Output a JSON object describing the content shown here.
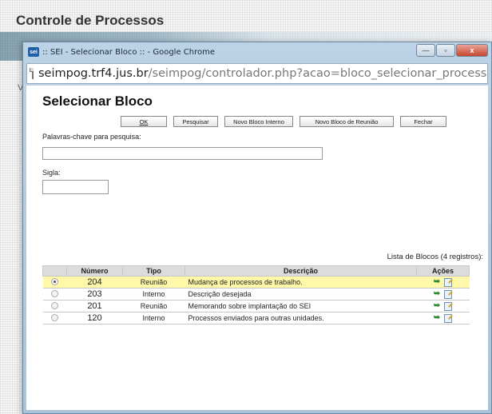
{
  "background": {
    "heading": "Controle de Processos",
    "left_letter": "V"
  },
  "window": {
    "title": ":: SEI - Selecionar Bloco :: - Google Chrome",
    "app_icon_label": "sei",
    "controls": {
      "minimize": "—",
      "maximize": "▫",
      "close": "x"
    }
  },
  "address": {
    "host": "seimpog.trf4.jus.br",
    "path": "/seimpog/controlador.php?acao=bloco_selecionar_processo&acao_origem=bl"
  },
  "page": {
    "title": "Selecionar Bloco",
    "buttons": {
      "ok": "OK",
      "pesquisar": "Pesquisar",
      "novo_interno": "Novo Bloco Interno",
      "novo_reuniao": "Novo Bloco de Reunião",
      "fechar": "Fechar"
    },
    "keywords_label": "Palavras-chave para pesquisa:",
    "keywords_value": "",
    "sigla_label": "Sigla:",
    "sigla_value": "",
    "table_caption": "Lista de Blocos (4 registros):",
    "table": {
      "headers": [
        "",
        "Número",
        "Tipo",
        "Descrição",
        "Ações"
      ],
      "rows": [
        {
          "numero": "204",
          "tipo": "Reunião",
          "descricao": "Mudança de processos de trabalho.",
          "selected": true
        },
        {
          "numero": "203",
          "tipo": "Interno",
          "descricao": "Descrição desejada",
          "selected": false
        },
        {
          "numero": "201",
          "tipo": "Reunião",
          "descricao": "Memorando sobre implantação do SEI",
          "selected": false
        },
        {
          "numero": "120",
          "tipo": "Interno",
          "descricao": "Processos enviados para outras unidades.",
          "selected": false
        }
      ]
    }
  },
  "colors": {
    "selected_row": "#fff8a8",
    "number_text": "#2a8a2a",
    "header_bg": "#dcdcdc"
  },
  "icons": {
    "action_include": "include-arrow-icon",
    "action_edit": "edit-icon"
  }
}
